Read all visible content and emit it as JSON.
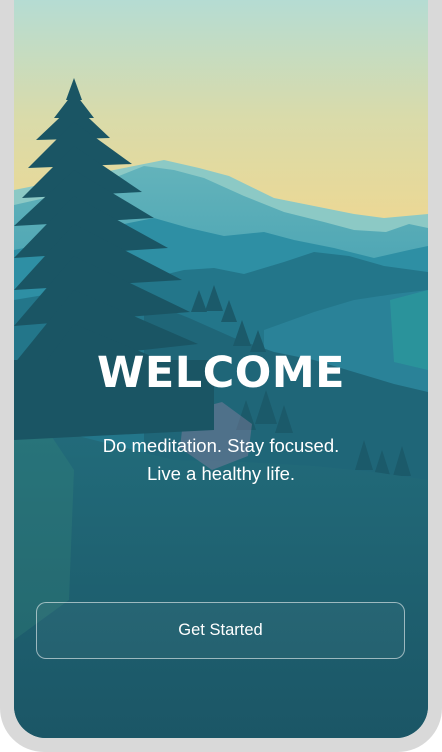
{
  "welcome": {
    "title": "WELCOME",
    "tagline_line1": "Do meditation. Stay focused.",
    "tagline_line2": "Live a healthy life."
  },
  "actions": {
    "get_started_label": "Get Started"
  },
  "colors": {
    "sky_top": "#b6dcd2",
    "sky_horizon": "#f1d98f",
    "far_mountains": "#4fa9b6",
    "mid_mountains": "#2d8a9b",
    "near_hills": "#216b7a",
    "foreground": "#1d5a68",
    "tree": "#1a5564",
    "text": "#ffffff",
    "frame": "#d9d9d9"
  },
  "icons": {
    "hero": "mountain-landscape-illustration"
  }
}
